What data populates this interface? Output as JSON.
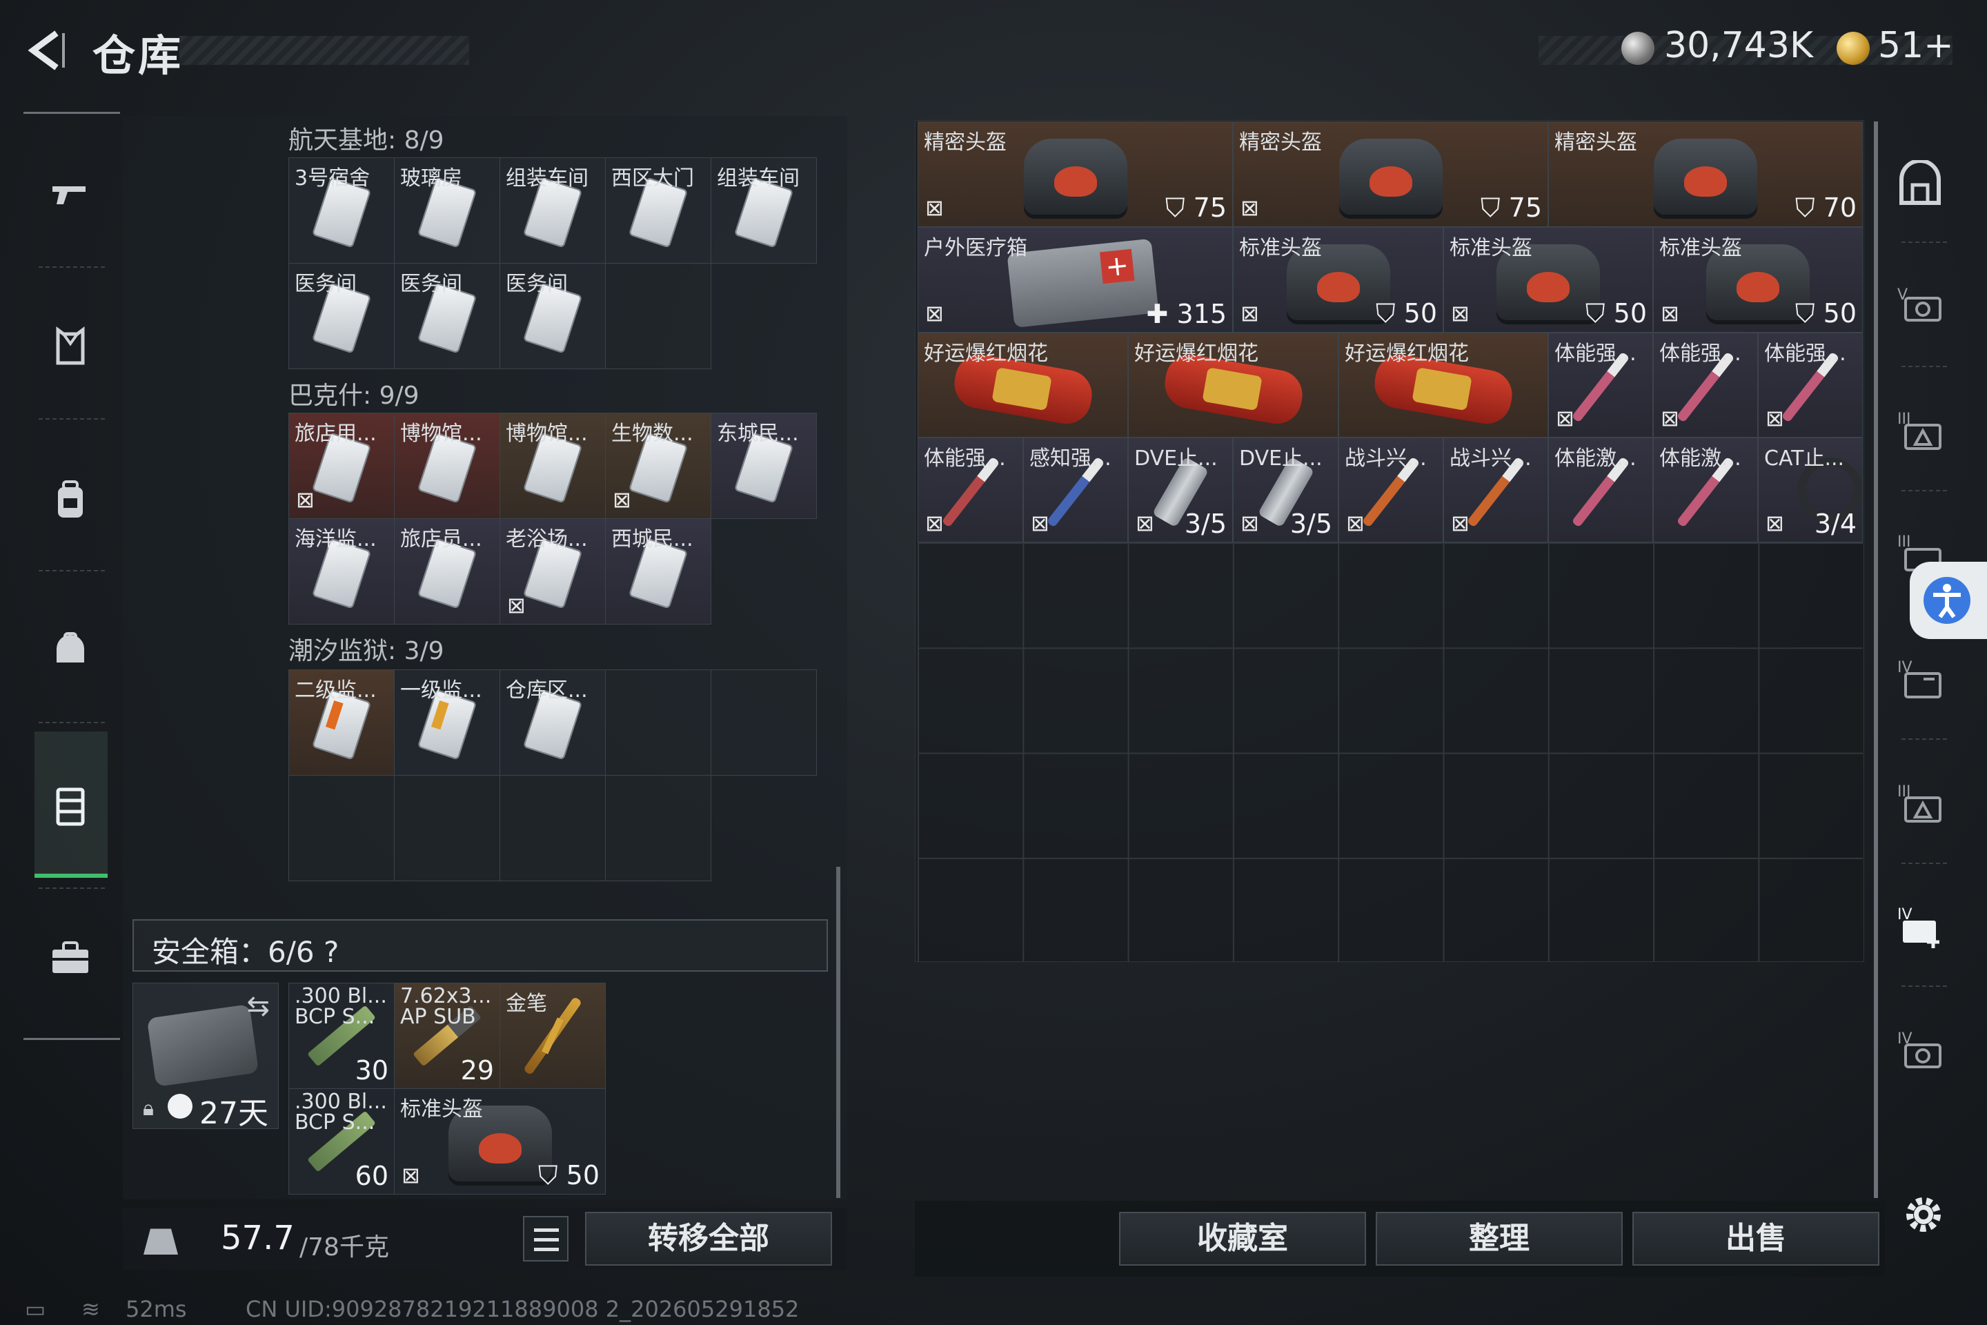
{
  "header": {
    "title": "仓库",
    "silver_amount": "30,743K",
    "gold_amount": "51+"
  },
  "left_rail": {
    "items": [
      "gun-icon",
      "armor-icon",
      "backpack-icon",
      "helmet-bag-icon",
      "warehouse-icon",
      "toolbox-icon"
    ],
    "active_index": 4
  },
  "keycards": {
    "groups": [
      {
        "label": "航天基地: 8/9",
        "items": [
          {
            "name": "3号宿舍"
          },
          {
            "name": "玻璃房"
          },
          {
            "name": "组装车间"
          },
          {
            "name": "西区大门"
          },
          {
            "name": "组装车间"
          },
          {
            "name": "医务间"
          },
          {
            "name": "医务间"
          },
          {
            "name": "医务间"
          }
        ]
      },
      {
        "label": "巴克什: 9/9",
        "items": [
          {
            "name": "旅店用..."
          },
          {
            "name": "博物馆..."
          },
          {
            "name": "博物馆..."
          },
          {
            "name": "生物数..."
          },
          {
            "name": "东城民..."
          },
          {
            "name": "海洋监..."
          },
          {
            "name": "旅店员..."
          },
          {
            "name": "老浴场..."
          },
          {
            "name": "西城民..."
          }
        ]
      },
      {
        "label": "潮汐监狱: 3/9",
        "items": [
          {
            "name": "二级监..."
          },
          {
            "name": "一级监..."
          },
          {
            "name": "仓库区..."
          }
        ]
      }
    ]
  },
  "safe_box": {
    "label": "安全箱：6/6",
    "help": "?",
    "days": "27天",
    "items": [
      {
        "name": ".300 Bl... BCP S...",
        "count": "30"
      },
      {
        "name": "7.62x3... AP SUB",
        "count": "29"
      },
      {
        "name": "金笔",
        "count": ""
      },
      {
        "name": ".300 Bl... BCP S...",
        "count": "60"
      },
      {
        "name": "标准头盔",
        "count": "50"
      }
    ]
  },
  "weight": {
    "current": "57.7",
    "max": "/78千克"
  },
  "buttons": {
    "transfer_all": "转移全部",
    "collection": "收藏室",
    "organize": "整理",
    "sell": "出售"
  },
  "storage": {
    "items": [
      {
        "name": "精密头盔",
        "value": "75"
      },
      {
        "name": "精密头盔",
        "value": "75"
      },
      {
        "name": "精密头盔",
        "value": "70"
      },
      {
        "name": "户外医疗箱",
        "value": "315"
      },
      {
        "name": "标准头盔",
        "value": "50"
      },
      {
        "name": "标准头盔",
        "value": "50"
      },
      {
        "name": "标准头盔",
        "value": "50"
      },
      {
        "name": "好运爆红烟花",
        "value": ""
      },
      {
        "name": "好运爆红烟花",
        "value": ""
      },
      {
        "name": "好运爆红烟花",
        "value": ""
      },
      {
        "name": "体能强...",
        "value": ""
      },
      {
        "name": "体能强...",
        "value": ""
      },
      {
        "name": "体能强...",
        "value": ""
      },
      {
        "name": "体能强...",
        "value": ""
      },
      {
        "name": "感知强...",
        "value": ""
      },
      {
        "name": "DVE止...",
        "value": "3/5"
      },
      {
        "name": "DVE止...",
        "value": "3/5"
      },
      {
        "name": "战斗兴...",
        "value": ""
      },
      {
        "name": "战斗兴...",
        "value": ""
      },
      {
        "name": "体能激...",
        "value": ""
      },
      {
        "name": "体能激...",
        "value": ""
      },
      {
        "name": "CAT止...",
        "value": "3/4"
      }
    ]
  },
  "right_rail": {
    "items": [
      "armory-icon",
      "tier-v-icon",
      "tier-iii-icon",
      "tier-iii-alt-icon",
      "tier-iv-icon",
      "tier-iii-b-icon",
      "tier-iv-add-icon",
      "tier-iv-b-icon"
    ]
  },
  "footer": {
    "ping": "52ms",
    "uid": "CN UID:9092878219211889008 2_202605291852"
  }
}
